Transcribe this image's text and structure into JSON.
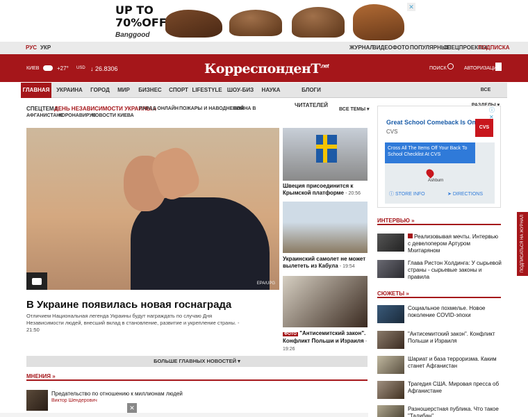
{
  "ad_banner": {
    "line1": "UP TO",
    "line2": "70%OFF",
    "brand": "Banggood",
    "close": "✕"
  },
  "topbar": {
    "lang": [
      "РУС",
      "УКР"
    ],
    "links": [
      "ЖУРНАЛ",
      "ВИДЕО",
      "ФОТО",
      "ПОПУЛЯРНЫЕ",
      "СПЕЦПРОЕКТЫ",
      "ПОДПИСКА"
    ]
  },
  "header": {
    "city": "КИЕВ",
    "temp": "+27°",
    "currency": "USD",
    "rate": "↓ 26.8306",
    "logo": "КорреспонденТ",
    "logo_suffix": ".net",
    "search": "ПОИСК",
    "auth": "АВТОРИЗАЦИЯ"
  },
  "nav": {
    "items": [
      "ГЛАВНАЯ",
      "УКРАИНА",
      "ГОРОД",
      "МИР",
      "БИЗНЕС",
      "СПОРТ",
      "LIFESTYLE",
      "ШОУ-БИЗ",
      "НАУКА",
      "БЛОГИ ЧИТАТЕЛЕЙ"
    ],
    "all": "ВСЕ РАЗДЕЛЫ"
  },
  "specthemes": {
    "label": "СПЕЦТЕМА:",
    "main": "ДЕНЬ НЕЗАВИСИМОСТИ УКРАИНЫ »",
    "items_row1": [
      "ПАРАД ОНЛАЙН",
      "ПОЖАРЫ И НАВОДНЕНИЯ",
      "ВОЙНА В"
    ],
    "items_row2": [
      "АФГАНИСТАНЕ",
      "КОРОНАВИРУС",
      "НОВОСТИ КИЕВА"
    ],
    "all": "ВСЕ ТЕМЫ"
  },
  "hero": {
    "title": "В Украине появилась новая госнаграда",
    "lead": "Отличием Национальная легенда Украины будут награждать по случаю Дня Независимости людей, внесший вклад в становление, развитие и укрепление страны. - 21:50",
    "credit": "EPA/UPG"
  },
  "side_news": [
    {
      "title": "Швеция присоединится к Крымской платформе",
      "time": "- 20:56"
    },
    {
      "title": "Украинский самолет не может вылететь из Кабула",
      "time": "- 19:54"
    },
    {
      "tag": "ФОТО",
      "title": "\"Антисемитский закон\". Конфликт Польши и Израиля",
      "time": "- 19:26"
    }
  ],
  "more_button": "БОЛЬШЕ ГЛАВНЫХ НОВОСТЕЙ",
  "opinions": {
    "title": "МНЕНИЯ »",
    "item": {
      "title": "Предательство по отношению к миллионам людей",
      "author": "Виктор Шендерович"
    }
  },
  "right_ad": {
    "title": "Great School Comeback Is On",
    "brand": "CVS",
    "map_text": "Cross All The Items Off Your Back To School Checklist At CVS",
    "place": "Ashburn",
    "store_info": "STORE INFO",
    "directions": "DIRECTIONS"
  },
  "interview": {
    "title": "ИНТЕРВЬЮ »",
    "items": [
      {
        "title": "Реализовывая мечты. Интервью с девелопером Артуром Мхитаряном"
      },
      {
        "title": "Глава Ристон Холдинга: У сырьевой страны - сырьевые законы и правила"
      }
    ]
  },
  "stories": {
    "title": "СЮЖЕТЫ »",
    "items": [
      {
        "title": "Социальное похмелье. Новое поколение COVID-эпохи"
      },
      {
        "title": "\"Антисемитский закон\". Конфликт Польши и Израиля"
      },
      {
        "title": "Шариат и база терроризма. Каким станет Афганистан"
      },
      {
        "title": "Трагедия США. Мировая пресса об Афганистане"
      },
      {
        "title": "Разношерстная публика. Что такое \"Талибан\""
      }
    ]
  },
  "side_tab": "ПОДПИСАТЬСЯ НА ЖУРНАЛ",
  "colors": {
    "brand": "#a5161a"
  }
}
